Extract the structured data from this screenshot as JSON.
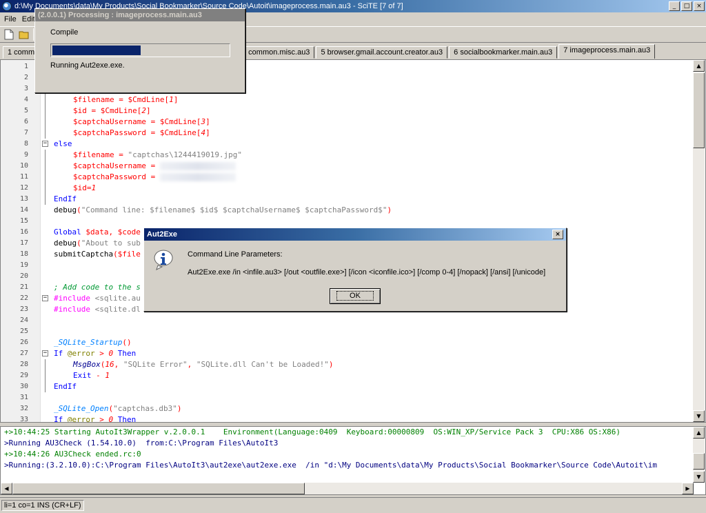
{
  "window": {
    "title": "d:\\My Documents\\data\\My Products\\Social Bookmarker\\Source Code\\Autoit\\imageprocess.main.au3 - SciTE [7 of 7]",
    "controls": [
      "_",
      "□",
      "×"
    ]
  },
  "menu": {
    "file_label": "File",
    "edit_label": "Edit"
  },
  "toolbar": {
    "icons": [
      "new-file-icon",
      "open-folder-icon"
    ]
  },
  "tabs": [
    {
      "label": "1 common",
      "active": false
    },
    {
      "label": "3 common.misc.au3",
      "active": false
    },
    {
      "label": "5 browser.gmail.account.creator.au3",
      "active": false
    },
    {
      "label": "6 socialbookmarker.main.au3",
      "active": false
    },
    {
      "label": "7 imageprocess.main.au3",
      "active": true
    }
  ],
  "editor": {
    "lines": [
      {
        "n": "1",
        "text": ""
      },
      {
        "n": "2",
        "text": ""
      },
      {
        "n": "3",
        "text": ""
      },
      {
        "n": "4",
        "text": "$filename = $CmdLine[1]"
      },
      {
        "n": "5",
        "text": "$id = $CmdLine[2]"
      },
      {
        "n": "6",
        "text": "$captchaUsername = $CmdLine[3]"
      },
      {
        "n": "7",
        "text": "$captchaPassword = $CmdLine[4]"
      },
      {
        "n": "8",
        "text": "else"
      },
      {
        "n": "9",
        "text": "$filename = \"captchas\\1244419019.jpg\""
      },
      {
        "n": "10",
        "text": "$captchaUsername ="
      },
      {
        "n": "11",
        "text": "$captchaPassword ="
      },
      {
        "n": "12",
        "text": "$id=1"
      },
      {
        "n": "13",
        "text": "EndIf"
      },
      {
        "n": "14",
        "text": "debug(\"Command line: $filename$ $id$ $captchaUsername$ $captchaPassword$\")"
      },
      {
        "n": "15",
        "text": ""
      },
      {
        "n": "16",
        "text": "Global $data, $code"
      },
      {
        "n": "17",
        "text": "debug(\"About to sub"
      },
      {
        "n": "18",
        "text": "submitCaptcha($file"
      },
      {
        "n": "19",
        "text": ""
      },
      {
        "n": "20",
        "text": ""
      },
      {
        "n": "21",
        "text": "; Add code to the s"
      },
      {
        "n": "22",
        "text": "#include <sqlite.au"
      },
      {
        "n": "23",
        "text": "#include <sqlite.dl"
      },
      {
        "n": "24",
        "text": ""
      },
      {
        "n": "25",
        "text": ""
      },
      {
        "n": "26",
        "text": "_SQLite_Startup()"
      },
      {
        "n": "27",
        "text": "If @error > 0 Then"
      },
      {
        "n": "28",
        "text": "MsgBox(16, \"SQLite Error\", \"SQLite.dll Can't be Loaded!\")"
      },
      {
        "n": "29",
        "text": "Exit - 1"
      },
      {
        "n": "30",
        "text": "EndIf"
      },
      {
        "n": "31",
        "text": ""
      },
      {
        "n": "32",
        "text": "_SQLite_Open(\"captchas.db3\")"
      },
      {
        "n": "33",
        "text": "If @error > 0 Then"
      }
    ]
  },
  "output": {
    "lines": [
      "+>10:44:25 Starting AutoIt3Wrapper v.2.0.0.1    Environment(Language:0409  Keyboard:00000809  OS:WIN_XP/Service Pack 3  CPU:X86 OS:X86)",
      ">Running AU3Check (1.54.10.0)  from:C:\\Program Files\\AutoIt3",
      "+>10:44:26 AU3Check ended.rc:0",
      ">Running:(3.2.10.0):C:\\Program Files\\AutoIt3\\aut2exe\\aut2exe.exe  /in \"d:\\My Documents\\data\\My Products\\Social Bookmarker\\Source Code\\Autoit\\im"
    ]
  },
  "status": {
    "text": "li=1 co=1 INS (CR+LF)"
  },
  "compile_window": {
    "title": "(2.0.0.1) Processing : imageprocess.main.au3",
    "label": "Compile",
    "progress": 0.5,
    "status": "Running Aut2exe.exe."
  },
  "dialog": {
    "title": "Aut2Exe",
    "heading": "Command Line Parameters:",
    "usage": "Aut2Exe.exe /in <infile.au3> [/out <outfile.exe>] [/icon <iconfile.ico>] [/comp 0-4] [/nopack] [/ansi] [/unicode]",
    "ok_label": "OK",
    "icon": "information-icon"
  },
  "colors": {
    "title_active": "#0a246a",
    "keyword": "#0000ff",
    "variable": "#ff0000",
    "string": "#808080",
    "comment": "#009933",
    "output_green": "#008000",
    "output_navy": "#000080"
  }
}
